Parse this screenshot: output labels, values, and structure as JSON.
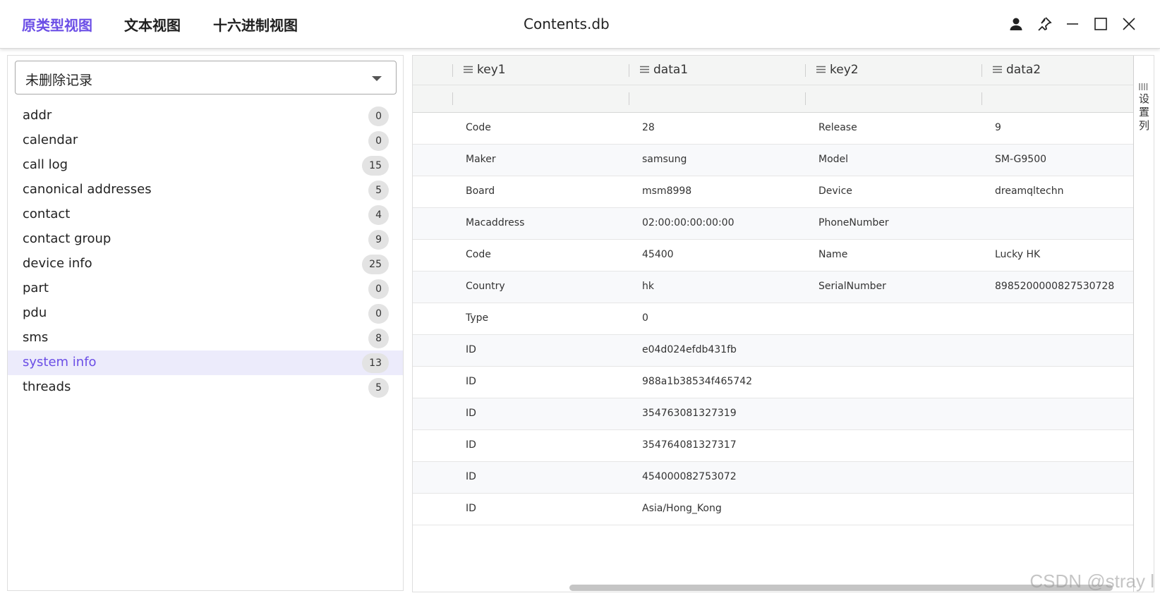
{
  "header": {
    "tabs": [
      "原类型视图",
      "文本视图",
      "十六进制视图"
    ],
    "title": "Contents.db",
    "icons": [
      "user-icon",
      "pin-icon",
      "minimize-icon",
      "maximize-icon",
      "close-icon"
    ]
  },
  "left": {
    "dropdown_value": "未删除记录",
    "items": [
      {
        "label": "addr",
        "count": "0"
      },
      {
        "label": "calendar",
        "count": "0"
      },
      {
        "label": "call log",
        "count": "15"
      },
      {
        "label": "canonical addresses",
        "count": "5"
      },
      {
        "label": "contact",
        "count": "4"
      },
      {
        "label": "contact group",
        "count": "9"
      },
      {
        "label": "device info",
        "count": "25"
      },
      {
        "label": "part",
        "count": "0"
      },
      {
        "label": "pdu",
        "count": "0"
      },
      {
        "label": "sms",
        "count": "8"
      },
      {
        "label": "system info",
        "count": "13"
      },
      {
        "label": "threads",
        "count": "5"
      }
    ],
    "selected": "system info"
  },
  "table": {
    "columns": [
      "key1",
      "data1",
      "key2",
      "data2"
    ],
    "rows": [
      [
        "Code",
        "28",
        "Release",
        "9"
      ],
      [
        "Maker",
        "samsung",
        "Model",
        "SM-G9500"
      ],
      [
        "Board",
        "msm8998",
        "Device",
        "dreamqltechn"
      ],
      [
        "Macaddress",
        "02:00:00:00:00:00",
        "PhoneNumber",
        ""
      ],
      [
        "Code",
        "45400",
        "Name",
        "Lucky HK"
      ],
      [
        "Country",
        "hk",
        "SerialNumber",
        "89852000008275307​28"
      ],
      [
        "Type",
        "0",
        "",
        ""
      ],
      [
        "ID",
        "e04d024efdb431fb",
        "",
        ""
      ],
      [
        "ID",
        "988a1b38534f465742",
        "",
        ""
      ],
      [
        "ID",
        "354763081327319",
        "",
        ""
      ],
      [
        "ID",
        "354764081327317",
        "",
        ""
      ],
      [
        "ID",
        "454000082753072",
        "",
        ""
      ],
      [
        "ID",
        "Asia/Hong_Kong",
        "",
        ""
      ]
    ],
    "settings_label": "设置列"
  },
  "watermark": "CSDN @stray l",
  "colors": {
    "accent": "#6b4ee6",
    "selected_bg": "#ecebfb"
  }
}
